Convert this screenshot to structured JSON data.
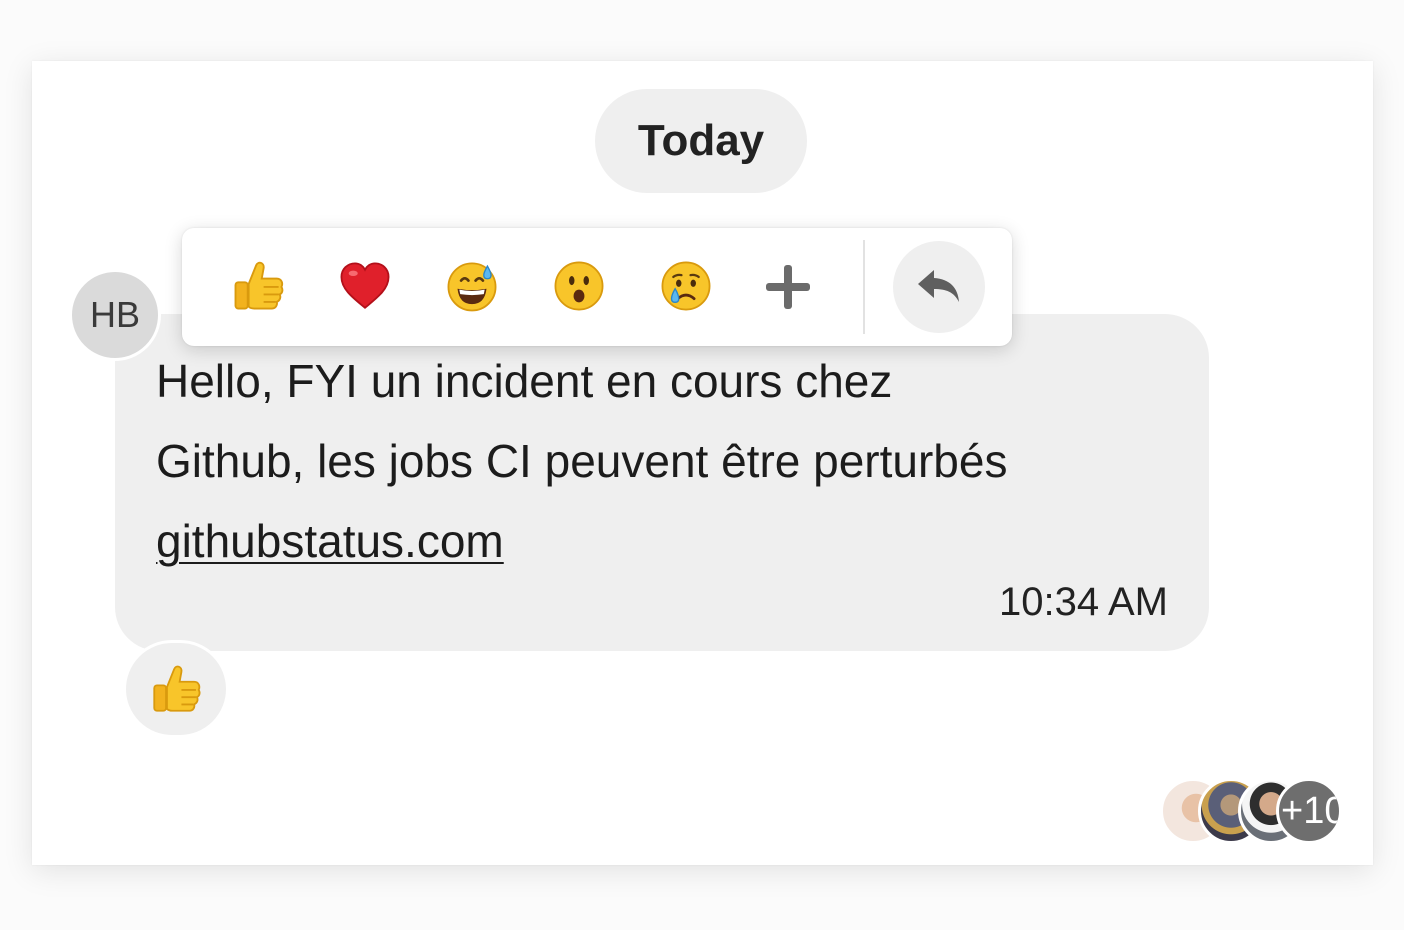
{
  "chat": {
    "date_divider": "Today",
    "message": {
      "author_initials": "HB",
      "line1": "Hello, FYI un incident en cours chez",
      "line2": "Github, les jobs CI peuvent être perturbés",
      "link_text": "githubstatus.com",
      "time": "10:34 AM"
    },
    "reaction_picker": {
      "emojis": [
        "thumbs-up",
        "red-heart",
        "grinning-face-with-sweat",
        "hushed-face",
        "crying-face"
      ],
      "more_icon": "plus-icon",
      "reply_icon": "reply-arrow-icon"
    },
    "reactions": [
      {
        "emoji": "thumbs-up"
      }
    ],
    "read_receipts": {
      "visible_avatars": 3,
      "more_label": "+10"
    }
  },
  "colors": {
    "bubble_background": "#efefef",
    "avatar_background": "#dadada",
    "emoji_yellow": "#f8c52a",
    "heart_red": "#e0202b",
    "icon_gray": "#6b6b6b"
  }
}
